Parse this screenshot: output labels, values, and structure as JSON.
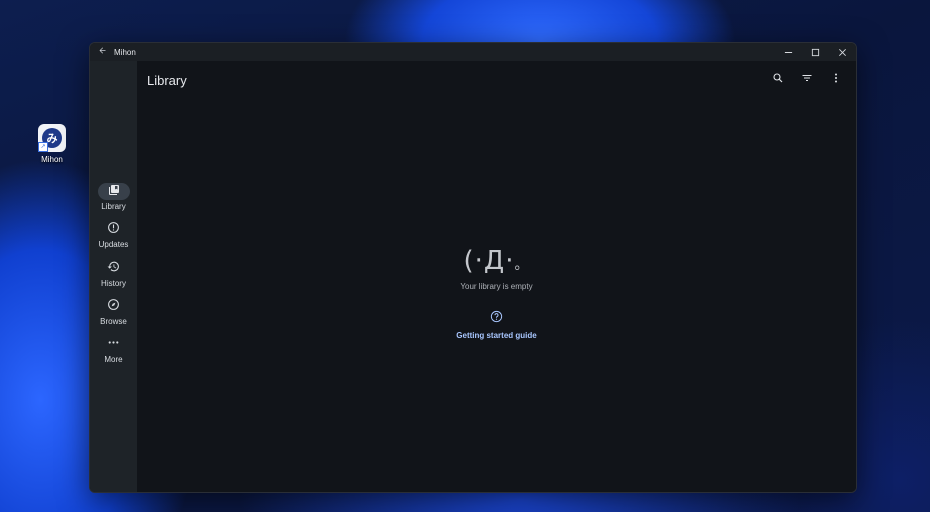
{
  "desktop": {
    "icon_label": "Mihon"
  },
  "window": {
    "title": "Mihon"
  },
  "rail": {
    "items": [
      {
        "label": "Library",
        "icon": "library-icon",
        "active": true
      },
      {
        "label": "Updates",
        "icon": "updates-icon",
        "active": false
      },
      {
        "label": "History",
        "icon": "history-icon",
        "active": false
      },
      {
        "label": "Browse",
        "icon": "browse-icon",
        "active": false
      },
      {
        "label": "More",
        "icon": "more-icon",
        "active": false
      }
    ]
  },
  "appbar": {
    "title": "Library"
  },
  "empty_state": {
    "face": "(·Д·",
    "face_tail": "。",
    "message": "Your library is empty",
    "guide_label": "Getting started guide"
  },
  "colors": {
    "accent": "#a9c7ff",
    "rail_bg": "#1e2328",
    "main_bg": "#111419"
  }
}
